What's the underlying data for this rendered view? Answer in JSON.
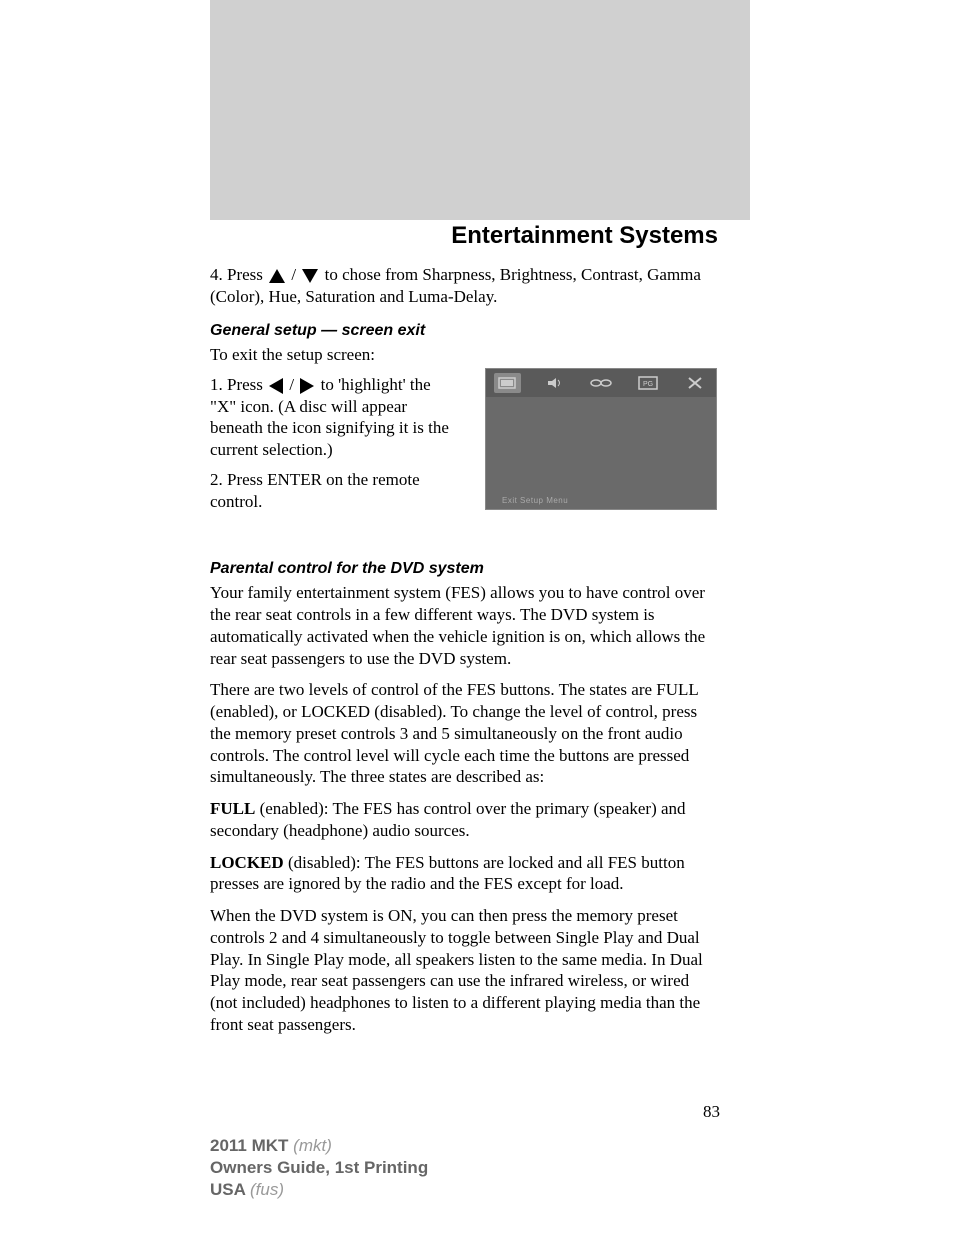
{
  "header": {
    "title": "Entertainment Systems"
  },
  "step4": {
    "prefix": "4. Press ",
    "mid": " / ",
    "suffix": " to chose from Sharpness, Brightness, Contrast, Gamma (Color), Hue, Saturation and Luma-Delay."
  },
  "section1": {
    "heading": "General setup — screen exit",
    "intro": "To exit the setup screen:",
    "step1_prefix": "1. Press ",
    "step1_mid": " / ",
    "step1_suffix": " to 'highlight' the \"X\" icon. (A disc will appear beneath the icon signifying it is the current selection.)",
    "step2": "2. Press ENTER on the remote control."
  },
  "screenshot_caption": "Exit Setup Menu",
  "section2": {
    "heading": "Parental control for the DVD system",
    "p1": "Your family entertainment system (FES) allows you to have control over the rear seat controls in a few different ways. The DVD system is automatically activated when the vehicle ignition is on, which allows the rear seat passengers to use the DVD system.",
    "p2": "There are two levels of control of the FES buttons. The states are FULL (enabled), or LOCKED (disabled). To change the level of control, press the memory preset controls 3 and 5 simultaneously on the front audio controls. The control level will cycle each time the buttons are pressed simultaneously. The three states are described as:",
    "full_label": "FULL",
    "full_text": " (enabled): The FES has control over the primary (speaker) and secondary (headphone) audio sources.",
    "locked_label": "LOCKED",
    "locked_text": " (disabled): The FES buttons are locked and all FES button presses are ignored by the radio and the FES except for load.",
    "p5": "When the DVD system is ON, you can then press the memory preset controls 2 and 4 simultaneously to toggle between Single Play and Dual Play. In Single Play mode, all speakers listen to the same media. In Dual Play mode, rear seat passengers can use the infrared wireless, or wired (not included) headphones to listen to a different playing media than the front seat passengers."
  },
  "page_number": "83",
  "footer": {
    "model_bold": "2011 MKT ",
    "model_italic": "(mkt)",
    "line2": "Owners Guide, 1st Printing",
    "usa_bold": "USA ",
    "usa_italic": "(fus)"
  }
}
